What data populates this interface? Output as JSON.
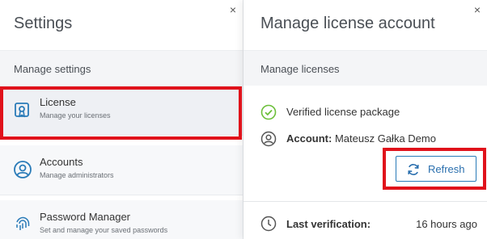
{
  "settings": {
    "title": "Settings",
    "close_glyph": "×",
    "section_label": "Manage settings",
    "items": [
      {
        "title": "License",
        "subtitle": "Manage your licenses",
        "icon": "license-icon",
        "selected": true
      },
      {
        "title": "Accounts",
        "subtitle": "Manage administrators",
        "icon": "account-icon",
        "selected": false
      },
      {
        "title": "Password Manager",
        "subtitle": "Set and manage your saved passwords",
        "icon": "fingerprint-icon",
        "selected": false
      }
    ]
  },
  "license_account": {
    "title": "Manage license account",
    "close_glyph": "×",
    "section_label": "Manage licenses",
    "verified_text": "Verified license package",
    "account_label": "Account:",
    "account_value": "Mateusz Gałka Demo",
    "refresh_label": "Refresh",
    "last_verification_label": "Last verification:",
    "last_verification_value": "16 hours ago"
  },
  "colors": {
    "accent": "#2a7bb8",
    "verified": "#6cbf3a",
    "highlight": "#e0121b"
  }
}
